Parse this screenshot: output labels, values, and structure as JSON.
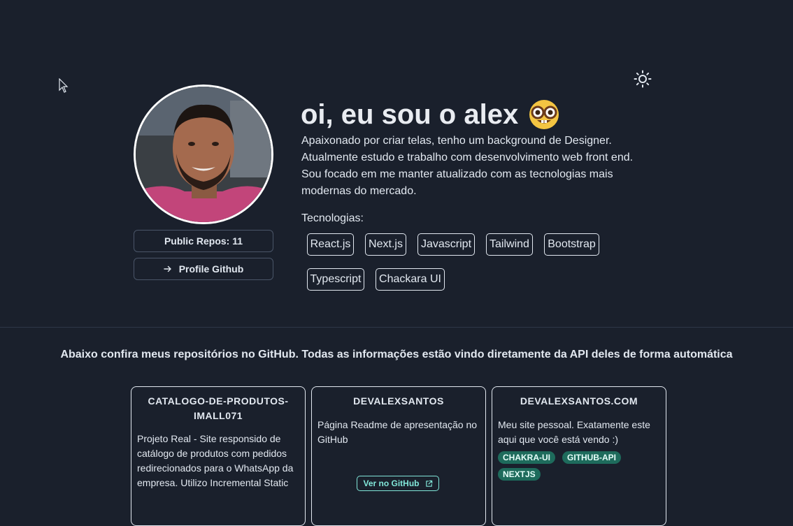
{
  "profile": {
    "repos_label": "Public Repos: 11",
    "github_label": "Profile Github"
  },
  "intro": {
    "title": "oi, eu sou o alex",
    "emoji": "🤓",
    "bio": [
      "Apaixonado por criar telas, tenho um background de Designer.",
      "Atualmente estudo e trabalho com desenvolvimento web front end.",
      "Sou focado em me manter atualizado com as tecnologias mais",
      "modernas do mercado."
    ],
    "tech_label": "Tecnologias:",
    "technologies": [
      "React.js",
      "Next.js",
      "Javascript",
      "Tailwind",
      "Bootstrap",
      "Typescript",
      "Chackara UI"
    ]
  },
  "repos": {
    "heading": "Abaixo confira meus repositórios no GitHub. Todas as informações estão vindo diretamente da API deles de forma automática",
    "cards": [
      {
        "title": "CATALOGO-DE-PRODUTOS-IMALL071",
        "title_lines": [
          "CATALOGO-DE-PRODUTOS-",
          "IMALL071"
        ],
        "description": "Projeto Real - Site responsido de catálogo de produtos com pedidos redirecionados para o WhatsApp da empresa. Utilizo Incremental Static",
        "tags": []
      },
      {
        "title": "DEVALEXSANTOS",
        "description": "Página Readme de apresentação no GitHub",
        "tags": [],
        "link_label": "Ver no GitHub"
      },
      {
        "title": "DEVALEXSANTOS.COM",
        "description": "Meu site pessoal. Exatamente este aqui que você está vendo :)",
        "tags": [
          "CHAKRA-UI",
          "GITHUB-API",
          "NEXTJS"
        ]
      }
    ]
  },
  "colors": {
    "background": "#1a202c",
    "text": "#e2e8f0",
    "tag_bg": "#1e6b5c",
    "link_accent": "#81e6d9"
  },
  "icons": {
    "cursor": "cursor-arrow-icon",
    "theme": "sun-icon",
    "github_arrow": "arrow-right-icon",
    "external": "external-link-icon"
  }
}
